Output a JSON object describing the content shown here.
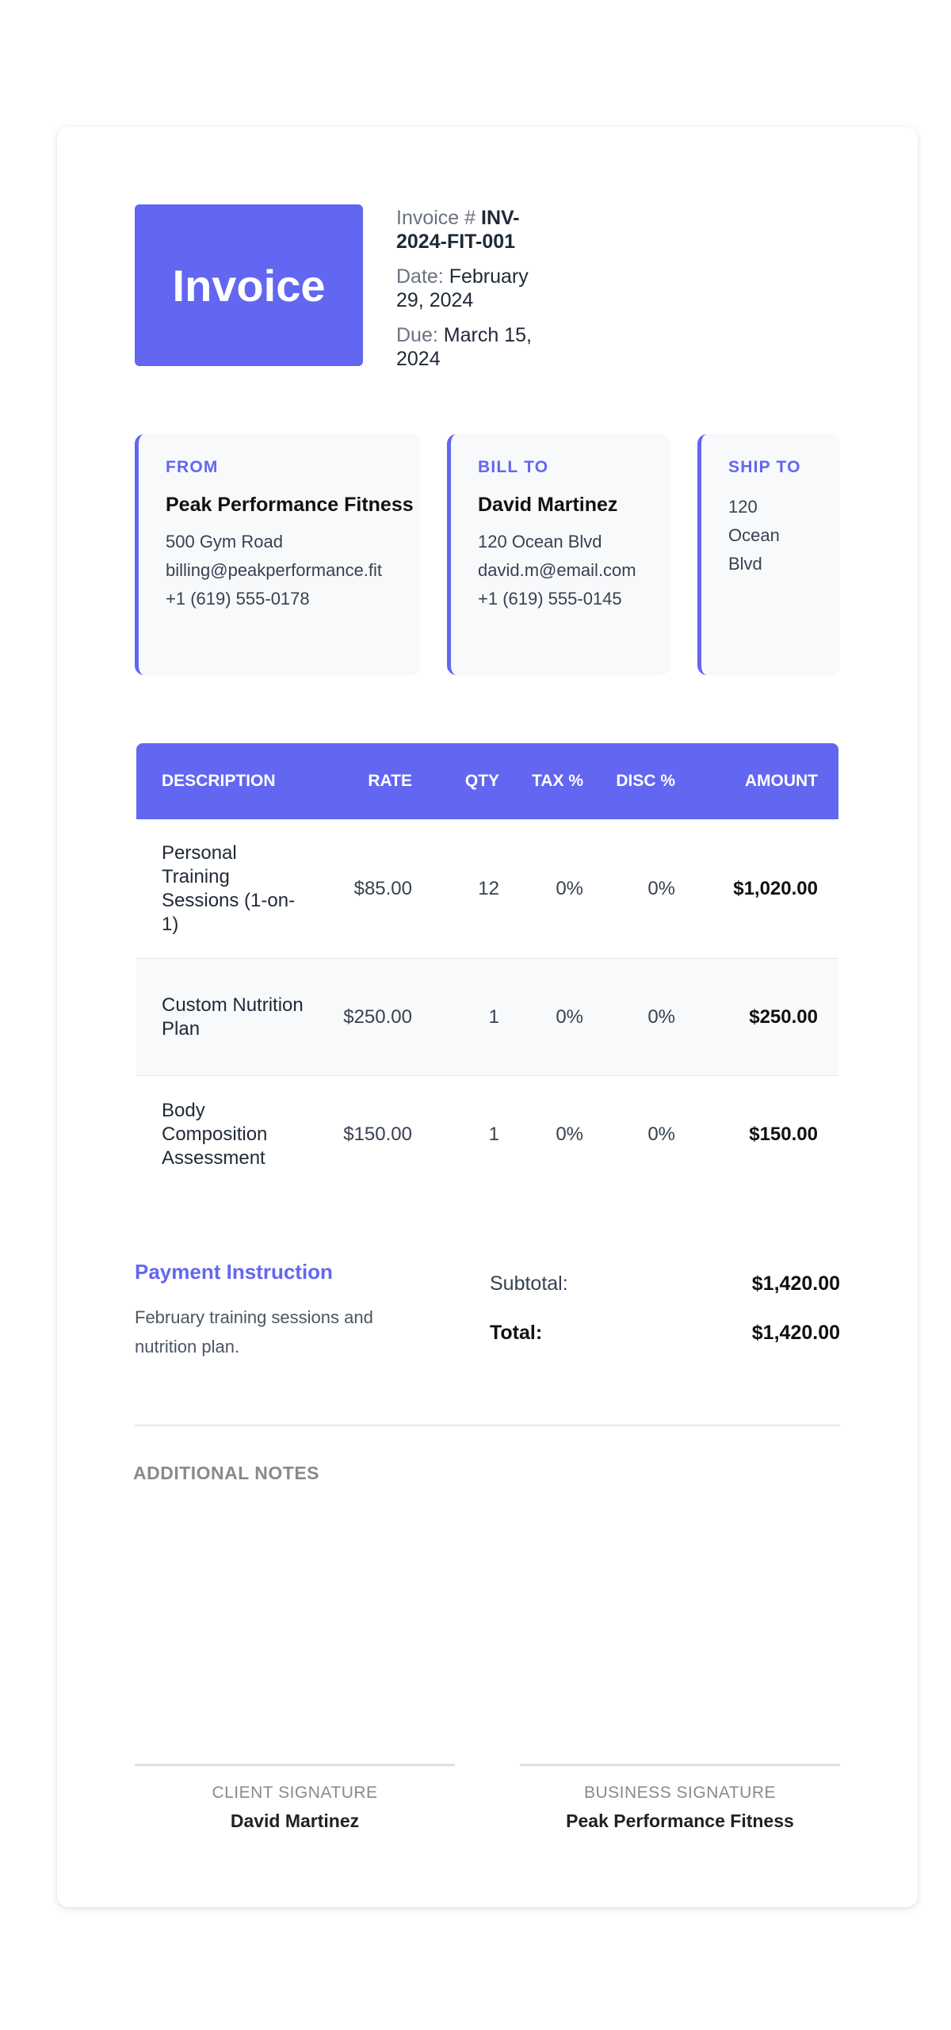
{
  "invoice": {
    "title": "Invoice",
    "number_label": "Invoice # ",
    "number": "INV-2024-FIT-001",
    "date_label": "Date: ",
    "date": "February 29, 2024",
    "due_label": "Due: ",
    "due": "March 15, 2024"
  },
  "from": {
    "heading": "FROM",
    "name": "Peak Performance Fitness",
    "lines": [
      "500 Gym Road",
      "billing@peakperformance.fit",
      "+1 (619) 555-0178"
    ]
  },
  "bill_to": {
    "heading": "BILL TO",
    "name": "David Martinez",
    "lines": [
      "120 Ocean Blvd",
      "david.m@email.com",
      "+1 (619) 555-0145"
    ]
  },
  "ship_to": {
    "heading": "SHIP TO",
    "lines": [
      "120",
      "Ocean",
      "Blvd"
    ]
  },
  "table": {
    "headers": {
      "description": "DESCRIPTION",
      "rate": "RATE",
      "qty": "QTY",
      "tax": "TAX %",
      "disc": "DISC %",
      "amount": "AMOUNT"
    },
    "rows": [
      {
        "description": "Personal Training Sessions (1-on-1)",
        "rate": "$85.00",
        "qty": "12",
        "tax": "0%",
        "disc": "0%",
        "amount": "$1,020.00"
      },
      {
        "description": "Custom Nutrition Plan",
        "rate": "$250.00",
        "qty": "1",
        "tax": "0%",
        "disc": "0%",
        "amount": "$250.00"
      },
      {
        "description": "Body Composition Assessment",
        "rate": "$150.00",
        "qty": "1",
        "tax": "0%",
        "disc": "0%",
        "amount": "$150.00"
      }
    ]
  },
  "payment": {
    "heading": "Payment Instruction",
    "text": "February training sessions and nutrition plan."
  },
  "totals": {
    "subtotal_label": "Subtotal:",
    "subtotal": "$1,420.00",
    "total_label": "Total:",
    "total": "$1,420.00"
  },
  "notes": {
    "heading": "ADDITIONAL NOTES"
  },
  "signatures": {
    "client_label": "CLIENT SIGNATURE",
    "client_name": "David Martinez",
    "business_label": "BUSINESS SIGNATURE",
    "business_name": "Peak Performance Fitness"
  },
  "colors": {
    "accent": "#6366f1",
    "panel": "#f8f9fb"
  }
}
